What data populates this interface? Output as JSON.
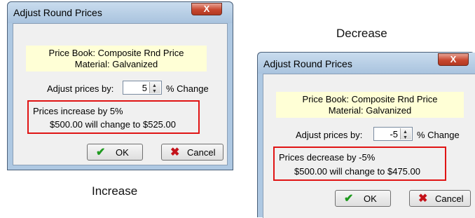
{
  "captions": {
    "increase": "Increase",
    "decrease": "Decrease"
  },
  "dialog_increase": {
    "title": "Adjust Round Prices",
    "close_glyph": "X",
    "price_book": "Price Book: Composite Rnd Price",
    "material": "Material: Galvanized",
    "adjust_label": "Adjust prices by:",
    "adjust_value": "5",
    "change_label": "% Change",
    "message_line1": "Prices increase by 5%",
    "message_line2": "$500.00 will change to $525.00",
    "ok_label": "OK",
    "cancel_label": "Cancel"
  },
  "dialog_decrease": {
    "title": "Adjust Round Prices",
    "close_glyph": "X",
    "price_book": "Price Book: Composite Rnd Price",
    "material": "Material: Galvanized",
    "adjust_label": "Adjust prices by:",
    "adjust_value": "-5",
    "change_label": "% Change",
    "message_line1": "Prices decrease by -5%",
    "message_line2": "$500.00 will change to $475.00",
    "ok_label": "OK",
    "cancel_label": "Cancel"
  },
  "icons": {
    "ok": "checkmark-icon",
    "cancel": "x-mark-icon"
  },
  "colors": {
    "highlight_border": "#e01414",
    "info_background": "#ffffd6",
    "dialog_frame": "#aec8e2",
    "close_button": "#c8472f"
  }
}
